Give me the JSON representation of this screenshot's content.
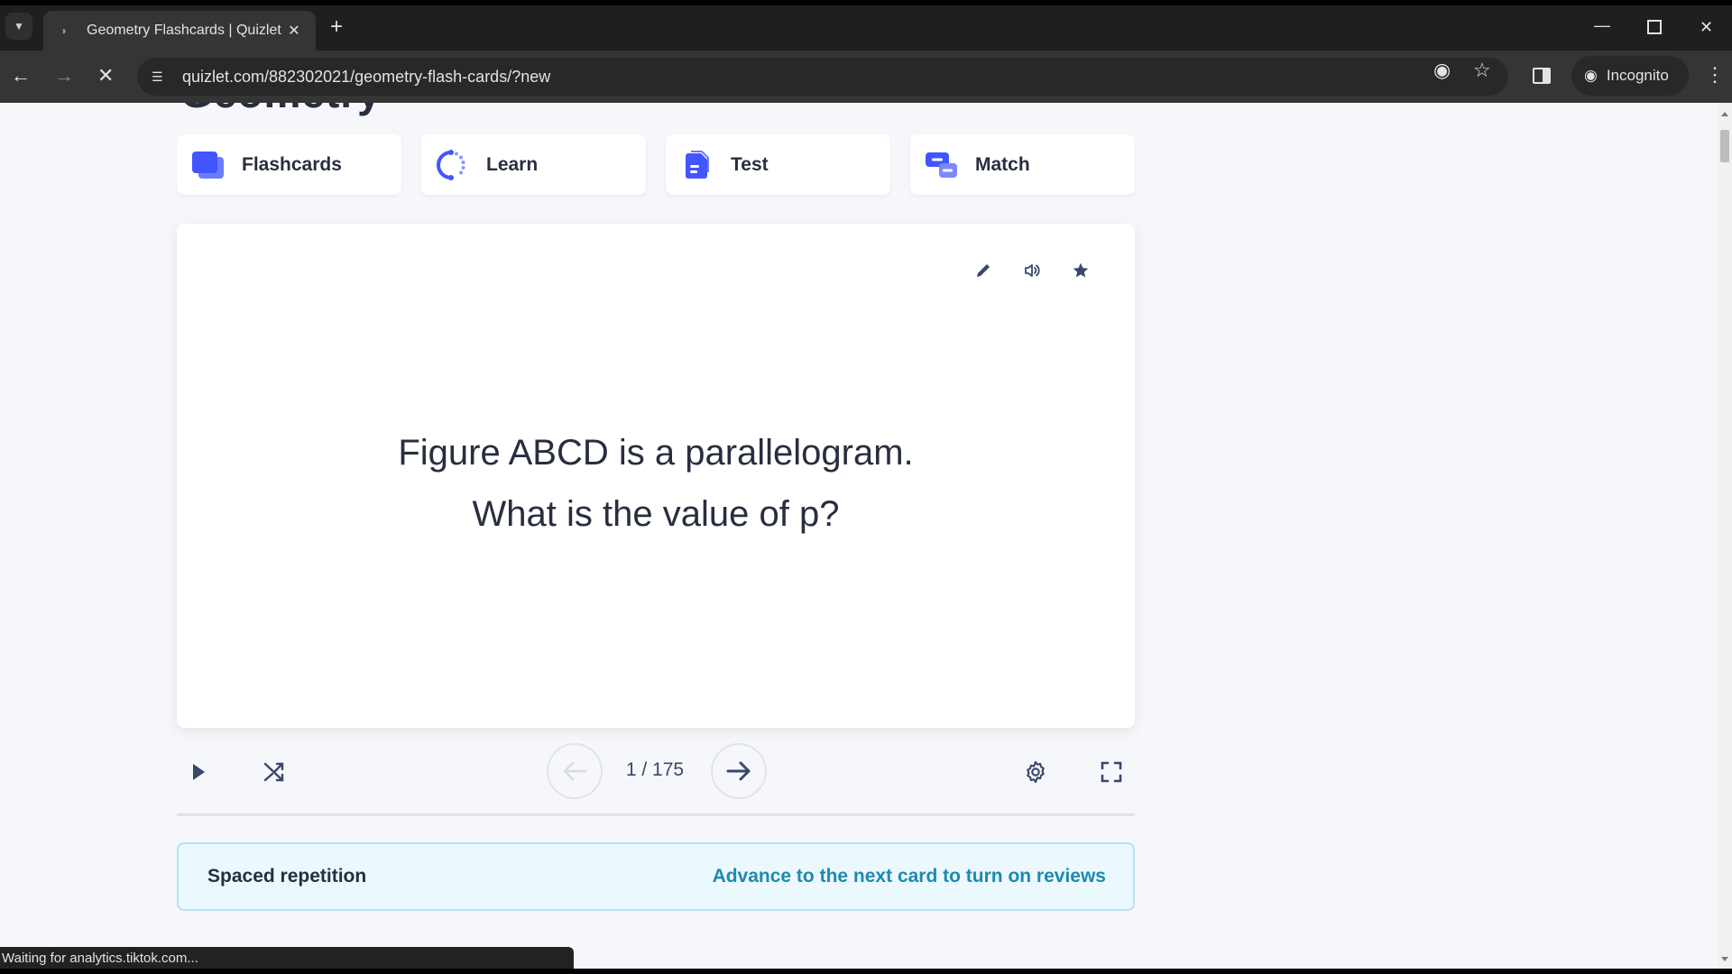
{
  "browser": {
    "tab_title": "Geometry Flashcards | Quizlet",
    "url": "quizlet.com/882302021/geometry-flash-cards/?new",
    "profile_label": "Incognito",
    "status_text": "Waiting for analytics.tiktok.com..."
  },
  "page": {
    "set_title": "Geometry",
    "study_modes": [
      {
        "label": "Flashcards",
        "icon": "flashcards-icon"
      },
      {
        "label": "Learn",
        "icon": "learn-icon"
      },
      {
        "label": "Test",
        "icon": "test-icon"
      },
      {
        "label": "Match",
        "icon": "match-icon"
      }
    ],
    "card": {
      "line1": "Figure ABCD is a parallelogram.",
      "line2": "What is the value of p?"
    },
    "controls": {
      "counter": "1 / 175",
      "current": 1,
      "total": 175
    },
    "spaced_repetition": {
      "label": "Spaced repetition",
      "link": "Advance to the next card to turn on reviews"
    }
  },
  "colors": {
    "brand_blue": "#4255ff",
    "brand_blue_light": "#6a7bff",
    "link_teal": "#1d8ab0",
    "text_dark": "#282e3e",
    "page_bg": "#f6f7fb"
  }
}
